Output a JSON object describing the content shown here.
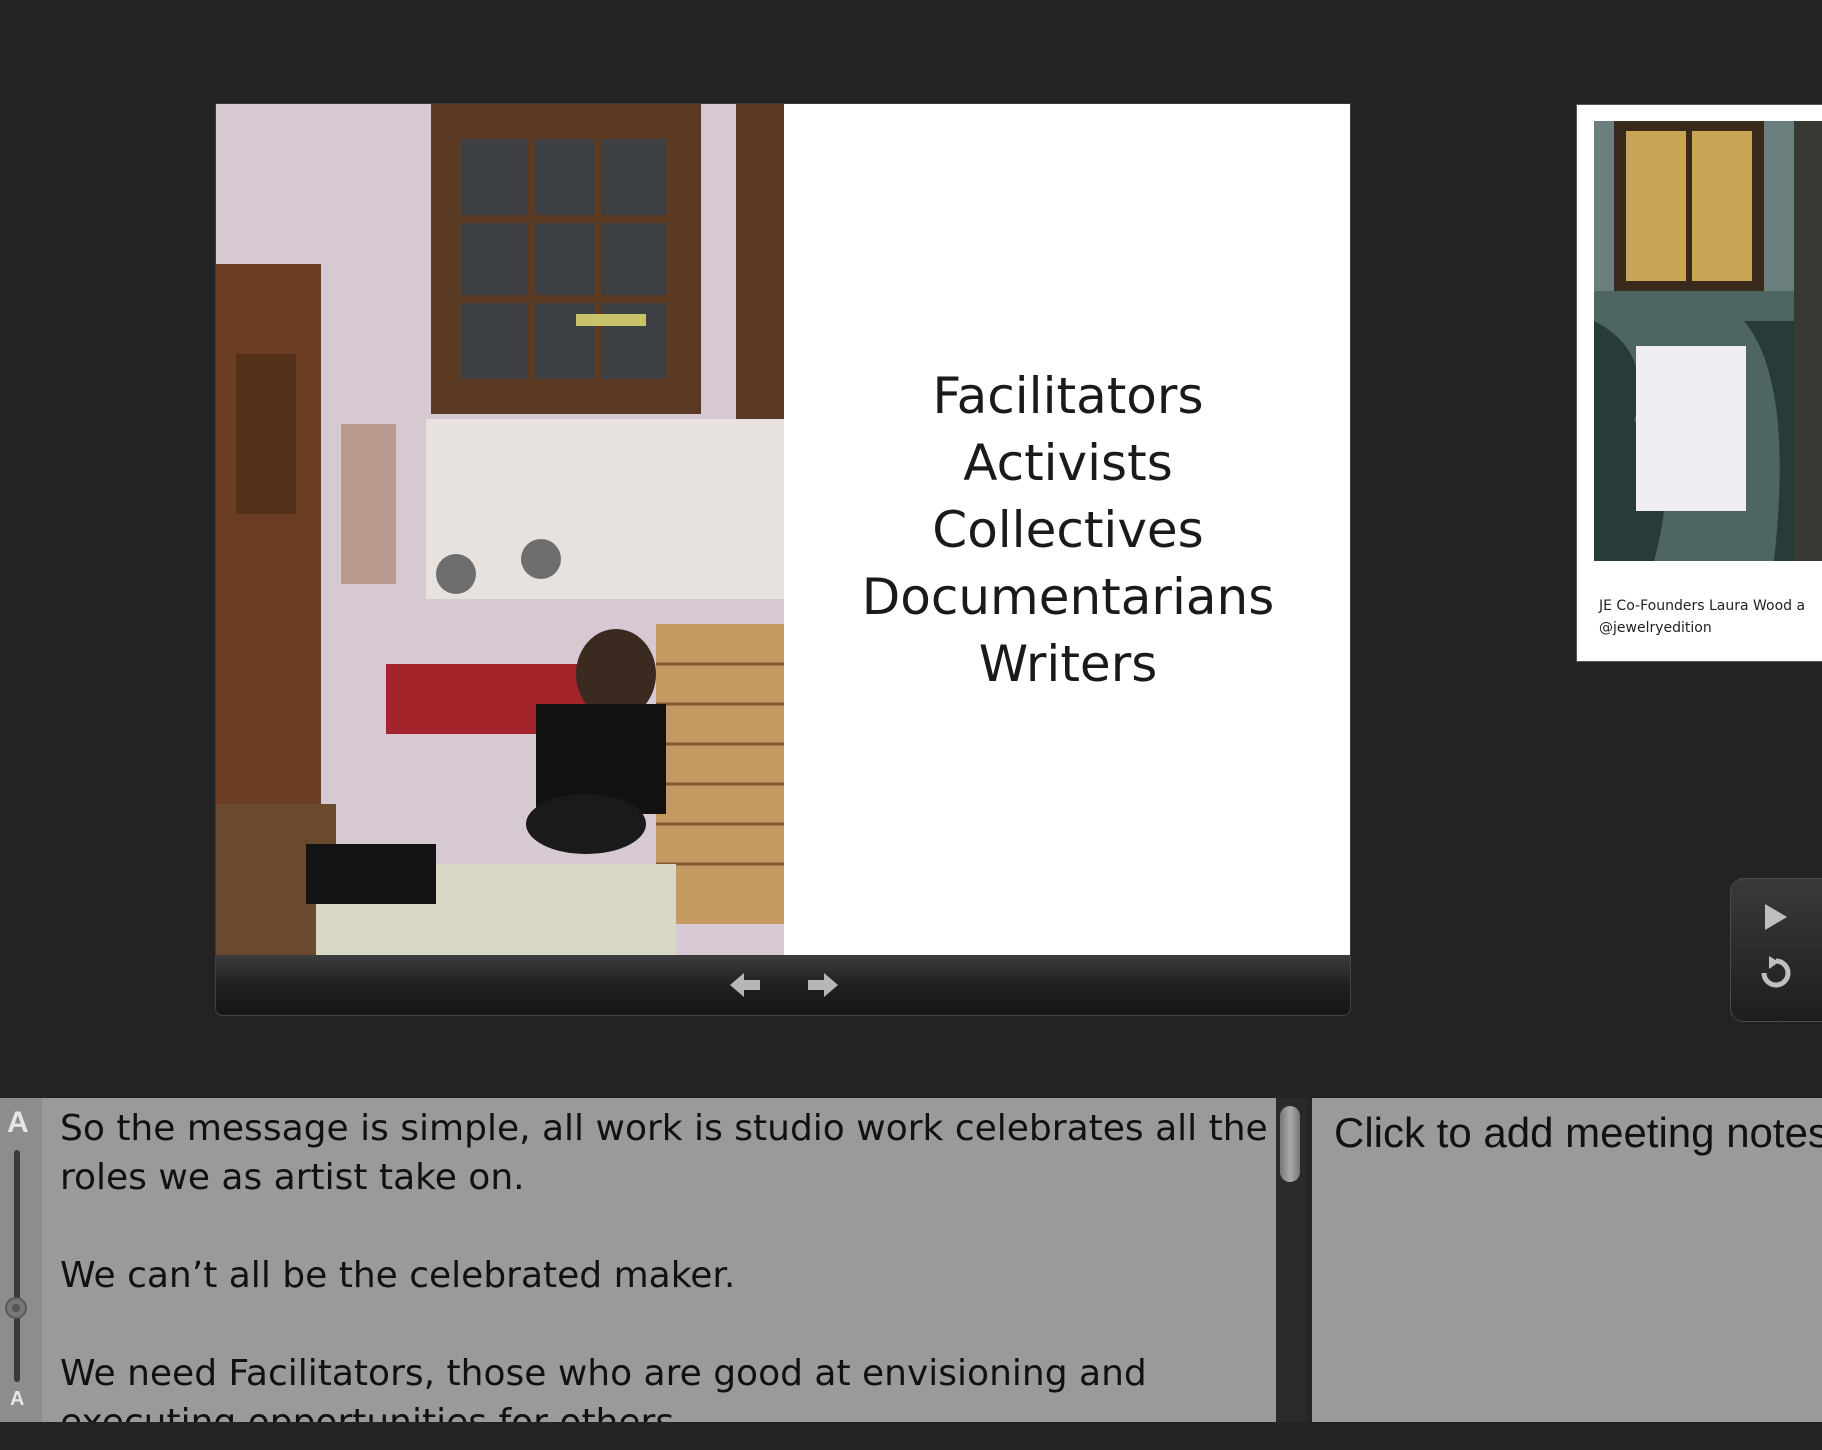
{
  "current_slide": {
    "lines": [
      "Facilitators",
      "Activists",
      "Collectives",
      "Documentarians",
      "Writers"
    ]
  },
  "next_slide": {
    "caption_line1": "JE Co-Founders Laura Wood a",
    "caption_line2": "@jewelryedition"
  },
  "navigation": {
    "prev_icon": "arrow-left-icon",
    "next_icon": "arrow-right-icon"
  },
  "playback": {
    "play_icon": "play-icon",
    "reset_icon": "reset-icon"
  },
  "notes": {
    "font_large_label": "A",
    "font_small_label": "A",
    "paragraphs": [
      "So the message is simple, all work is studio work celebrates all the roles we as artist take on.",
      "We can’t all be the celebrated maker.",
      "We need Facilitators, those who are good at envisioning and executing opportunities for others."
    ]
  },
  "meeting_notes": {
    "placeholder": "Click to add meeting notes"
  },
  "colors": {
    "background": "#232323",
    "notes_background": "#9a9a9a"
  }
}
